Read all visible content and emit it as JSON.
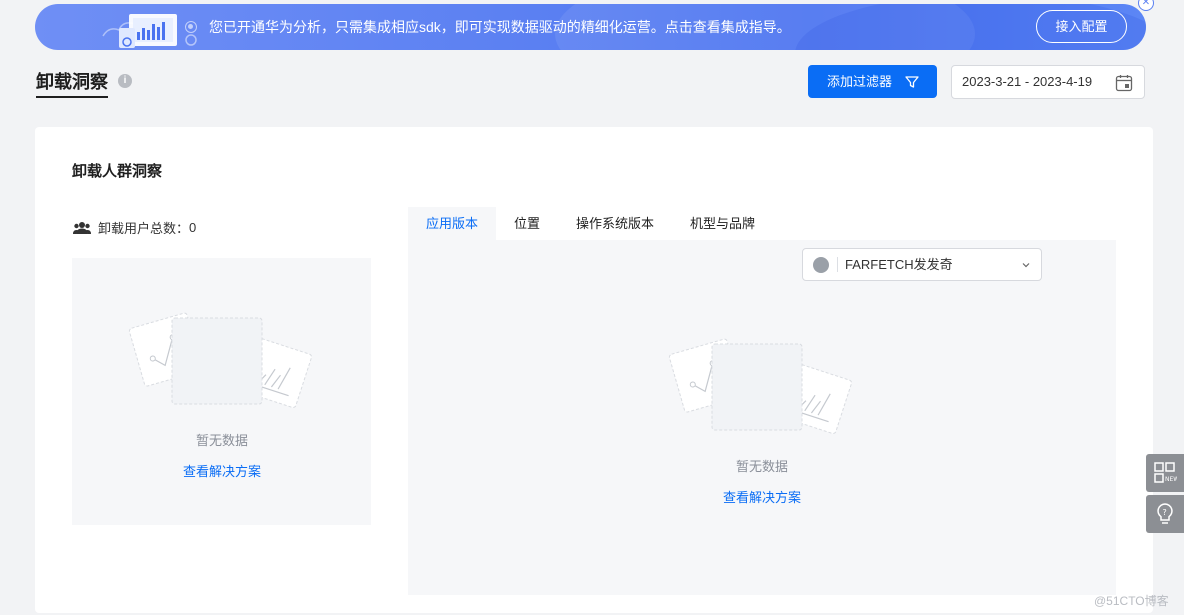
{
  "banner": {
    "text": "您已开通华为分析，只需集成相应sdk，即可实现数据驱动的精细化运营。点击查看集成指导。",
    "button_label": "接入配置"
  },
  "header": {
    "title": "卸载洞察",
    "filter_button": "添加过滤器",
    "date_range": "2023-3-21 - 2023-4-19"
  },
  "card": {
    "title": "卸载人群洞察",
    "users_label": "卸载用户总数：",
    "users_count": "0",
    "tabs": [
      "应用版本",
      "位置",
      "操作系统版本",
      "机型与品牌"
    ],
    "active_tab": 0,
    "app_select": "FARFETCH发发奇",
    "empty_left": {
      "message": "暂无数据",
      "link": "查看解决方案"
    },
    "empty_right": {
      "message": "暂无数据",
      "link": "查看解决方案"
    }
  },
  "watermark": "@51CTO博客",
  "colors": {
    "primary": "#0a6df5",
    "banner": "#5b80f2",
    "panel": "#f6f7f9"
  }
}
